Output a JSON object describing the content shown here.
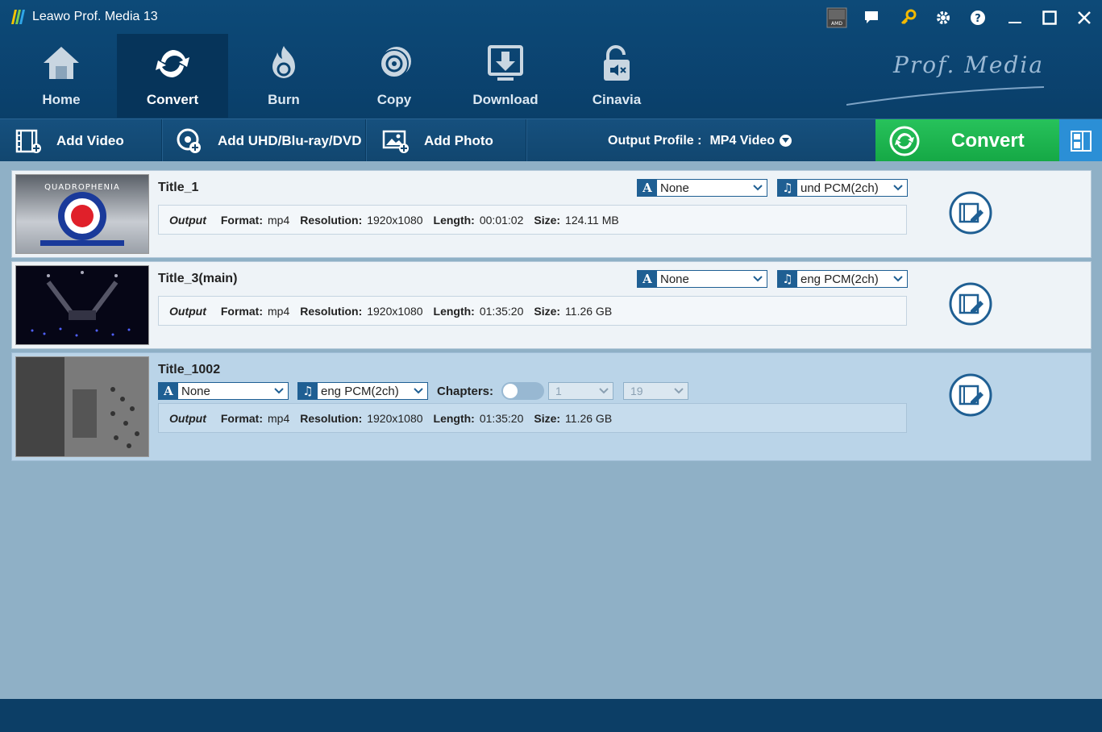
{
  "window": {
    "title": "Leawo Prof. Media 13",
    "icons": [
      "amd-icon",
      "feedback-icon",
      "key-icon",
      "settings-icon",
      "help-icon",
      "minimize-icon",
      "maximize-icon",
      "close-icon"
    ]
  },
  "nav": [
    {
      "label": "Home",
      "icon": "home-icon",
      "active": false
    },
    {
      "label": "Convert",
      "icon": "convert-icon",
      "active": true
    },
    {
      "label": "Burn",
      "icon": "burn-icon",
      "active": false
    },
    {
      "label": "Copy",
      "icon": "copy-icon",
      "active": false
    },
    {
      "label": "Download",
      "icon": "download-icon",
      "active": false
    },
    {
      "label": "Cinavia",
      "icon": "cinavia-icon",
      "active": false
    }
  ],
  "brand": "Prof. Media",
  "toolbar": {
    "add_video": "Add Video",
    "add_disc": "Add UHD/Blu-ray/DVD",
    "add_photo": "Add Photo",
    "profile_label": "Output Profile :",
    "profile_value": "MP4 Video",
    "convert": "Convert"
  },
  "labels": {
    "output": "Output",
    "format": "Format:",
    "resolution": "Resolution:",
    "length": "Length:",
    "size": "Size:",
    "chapters": "Chapters:"
  },
  "titles": [
    {
      "name": "Title_1",
      "subtitle": "None",
      "audio": "und PCM(2ch)",
      "format": "mp4",
      "resolution": "1920x1080",
      "length": "00:01:02",
      "size": "124.11 MB",
      "thumb_text": "QUADROPHENIA"
    },
    {
      "name": "Title_3(main)",
      "subtitle": "None",
      "audio": "eng PCM(2ch)",
      "format": "mp4",
      "resolution": "1920x1080",
      "length": "01:35:20",
      "size": "11.26 GB"
    },
    {
      "name": "Title_1002",
      "subtitle": "None",
      "audio": "eng PCM(2ch)",
      "format": "mp4",
      "resolution": "1920x1080",
      "length": "01:35:20",
      "size": "11.26 GB",
      "chapter_from": "1",
      "chapter_to": "19",
      "chapters_enabled": false,
      "selected": true
    }
  ],
  "colors": {
    "header": "#0b4370",
    "convert_green": "#1db34e",
    "accent_blue": "#1f5f93",
    "content_bg": "#8fb0c6"
  }
}
